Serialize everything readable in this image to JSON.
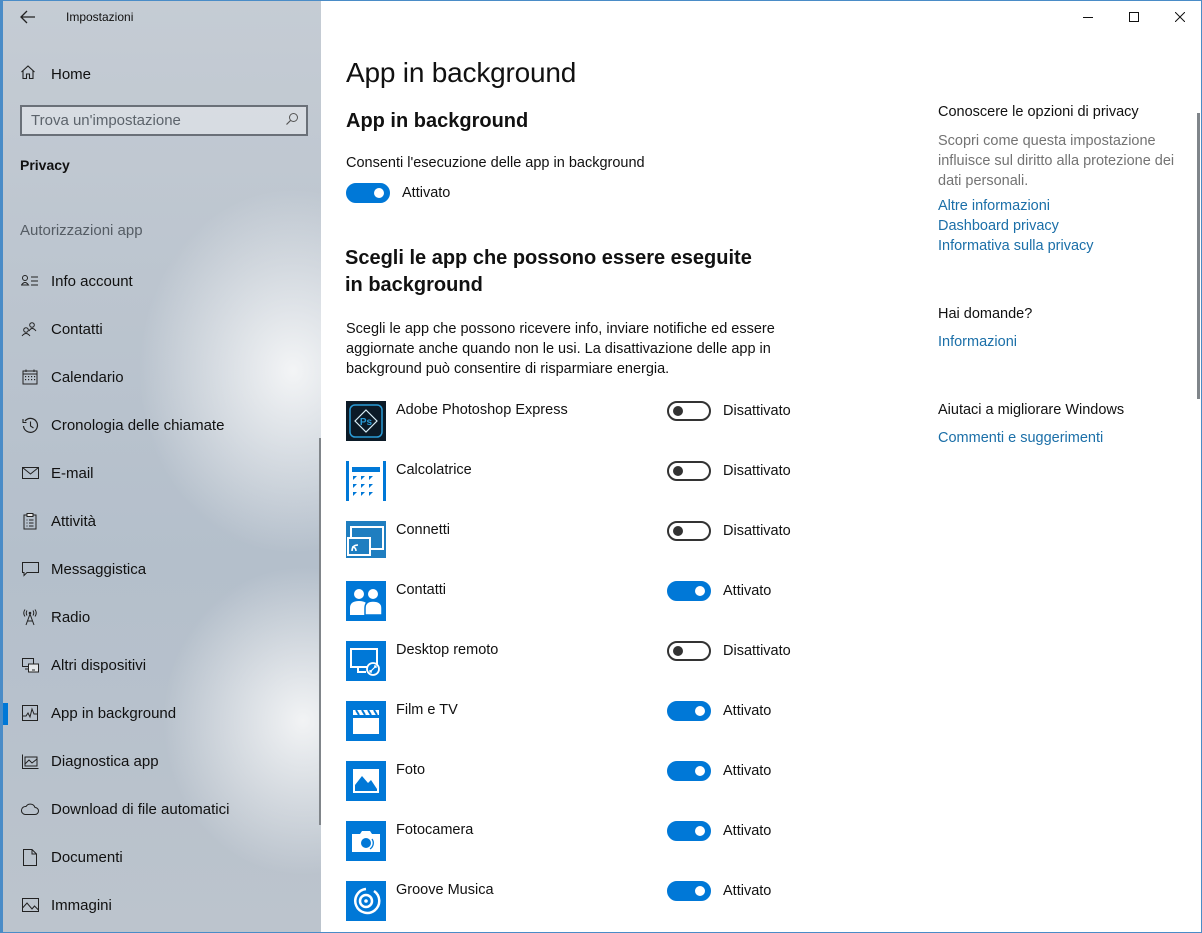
{
  "window": {
    "title": "Impostazioni",
    "controls": {
      "minimize": "minimize",
      "maximize": "maximize",
      "close": "close"
    }
  },
  "sidebar": {
    "home_label": "Home",
    "search_placeholder": "Trova un'impostazione",
    "section_title": "Privacy",
    "group_label": "Autorizzazioni app",
    "items": [
      {
        "label": "Info account",
        "icon": "account-info-icon",
        "active": false
      },
      {
        "label": "Contatti",
        "icon": "contacts-icon",
        "active": false
      },
      {
        "label": "Calendario",
        "icon": "calendar-icon",
        "active": false
      },
      {
        "label": "Cronologia delle chiamate",
        "icon": "history-icon",
        "active": false
      },
      {
        "label": "E-mail",
        "icon": "mail-icon",
        "active": false
      },
      {
        "label": "Attività",
        "icon": "tasks-icon",
        "active": false
      },
      {
        "label": "Messaggistica",
        "icon": "message-icon",
        "active": false
      },
      {
        "label": "Radio",
        "icon": "radio-icon",
        "active": false
      },
      {
        "label": "Altri dispositivi",
        "icon": "devices-icon",
        "active": false
      },
      {
        "label": "App in background",
        "icon": "background-apps-icon",
        "active": true
      },
      {
        "label": "Diagnostica app",
        "icon": "diagnostics-icon",
        "active": false
      },
      {
        "label": "Download di file automatici",
        "icon": "cloud-icon",
        "active": false
      },
      {
        "label": "Documenti",
        "icon": "document-icon",
        "active": false
      },
      {
        "label": "Immagini",
        "icon": "pictures-icon",
        "active": false
      }
    ]
  },
  "main": {
    "page_title": "App in background",
    "sub_title": "App in background",
    "consent_label": "Consenti l'esecuzione delle app in background",
    "consent_state": "Attivato",
    "consent_on": true,
    "choose_title": "Scegli le app che possono essere eseguite in background",
    "choose_desc": "Scegli le app che possono ricevere info, inviare notifiche ed essere aggiornate anche quando non le usi. La disattivazione delle app in background può consentire di risparmiare energia.",
    "apps": [
      {
        "name": "Adobe Photoshop Express",
        "icon": "photoshop-express-icon",
        "on": false,
        "state": "Disattivato"
      },
      {
        "name": "Calcolatrice",
        "icon": "calculator-icon",
        "on": false,
        "state": "Disattivato"
      },
      {
        "name": "Connetti",
        "icon": "connect-icon",
        "on": false,
        "state": "Disattivato"
      },
      {
        "name": "Contatti",
        "icon": "people-icon",
        "on": true,
        "state": "Attivato"
      },
      {
        "name": "Desktop remoto",
        "icon": "remote-desktop-icon",
        "on": false,
        "state": "Disattivato"
      },
      {
        "name": "Film e TV",
        "icon": "movies-tv-icon",
        "on": true,
        "state": "Attivato"
      },
      {
        "name": "Foto",
        "icon": "photos-icon",
        "on": true,
        "state": "Attivato"
      },
      {
        "name": "Fotocamera",
        "icon": "camera-icon",
        "on": true,
        "state": "Attivato"
      },
      {
        "name": "Groove Musica",
        "icon": "groove-music-icon",
        "on": true,
        "state": "Attivato"
      }
    ]
  },
  "right_panel": {
    "privacy_heading": "Conoscere le opzioni di privacy",
    "privacy_desc": "Scopri come questa impostazione influisce sul diritto alla protezione dei dati personali.",
    "links": [
      "Altre informazioni",
      "Dashboard privacy",
      "Informativa sulla privacy"
    ],
    "questions_heading": "Hai domande?",
    "questions_link": "Informazioni",
    "improve_heading": "Aiutaci a migliorare Windows",
    "improve_link": "Commenti e suggerimenti"
  },
  "colors": {
    "accent": "#0078d7",
    "link": "#1b6fa8",
    "app_tile": "#0078d7",
    "photoshop_tile": "#0b1a27"
  }
}
